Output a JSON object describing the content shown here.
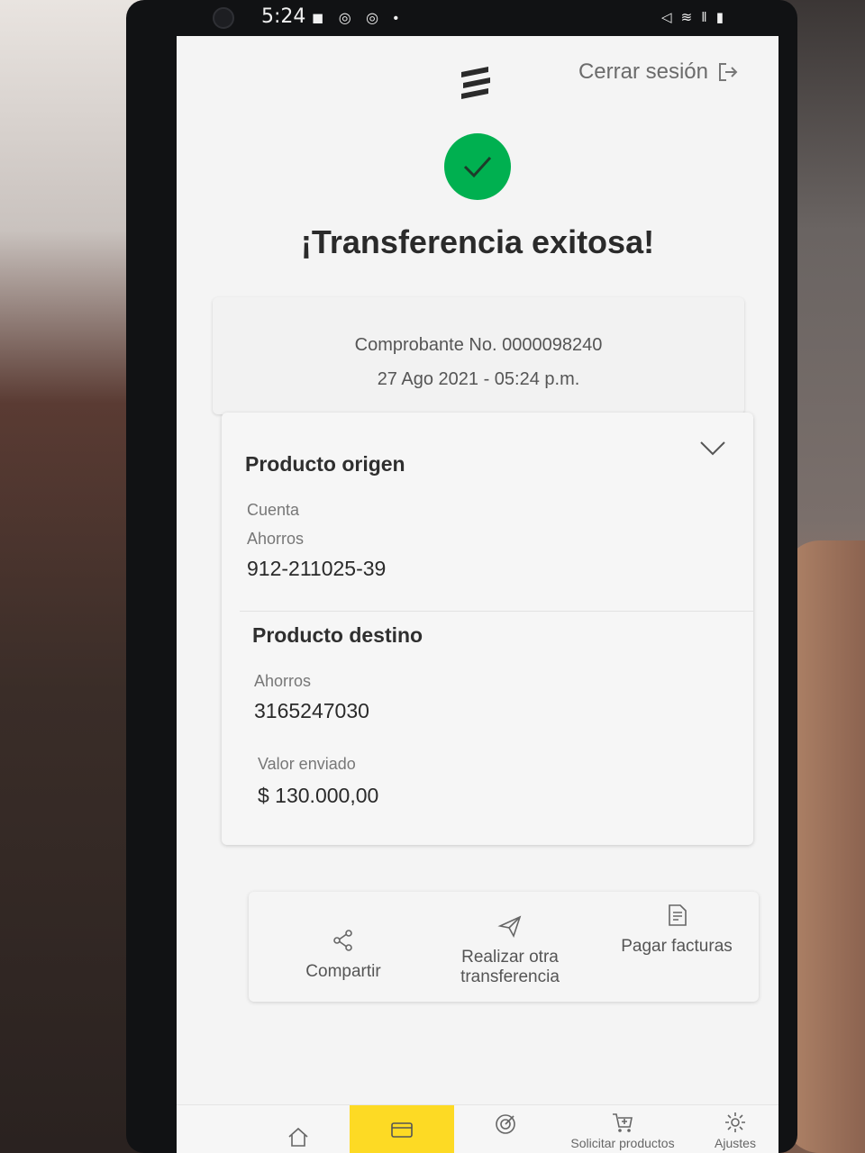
{
  "status_bar": {
    "time": "5:24",
    "notifications": "◼ ◎ ◎ •",
    "system": "◁ ≋ ‖ ▮"
  },
  "header": {
    "logout_label": "Cerrar sesión"
  },
  "title": "¡Transferencia exitosa!",
  "receipt": {
    "voucher": "Comprobante No. 0000098240",
    "datetime": "27 Ago 2021 - 05:24 p.m."
  },
  "origin": {
    "title": "Producto origen",
    "type_label": "Cuenta",
    "subtype_label": "Ahorros",
    "number": "912-211025-39"
  },
  "destination": {
    "title": "Producto destino",
    "subtype_label": "Ahorros",
    "number": "3165247030"
  },
  "amount": {
    "label": "Valor enviado",
    "value": "$ 130.000,00"
  },
  "actions": [
    {
      "label": "Compartir",
      "icon": "share-icon"
    },
    {
      "label_line1": "Realizar otra",
      "label_line2": "transferencia",
      "icon": "transfer-icon"
    },
    {
      "label": "Pagar facturas",
      "icon": "bill-icon"
    }
  ],
  "bottom_nav": [
    {
      "label": "",
      "icon": "home-icon"
    },
    {
      "label": "",
      "icon": "card-icon",
      "active": true
    },
    {
      "label": "",
      "icon": "target-icon"
    },
    {
      "label": "Solicitar productos",
      "icon": "cart-add-icon"
    },
    {
      "label": "Ajustes",
      "icon": "gear-icon"
    }
  ],
  "colors": {
    "success": "#00b050",
    "brand_yellow": "#fdda24"
  }
}
